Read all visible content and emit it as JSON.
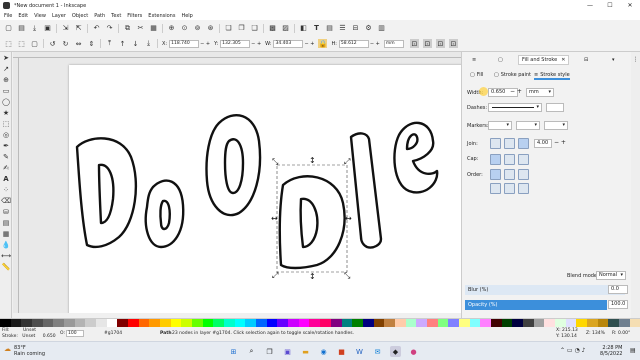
{
  "window": {
    "title": "*New document 1 - Inkscape",
    "minimize": "—",
    "maximize": "☐",
    "close": "✕"
  },
  "menu": [
    "File",
    "Edit",
    "View",
    "Layer",
    "Object",
    "Path",
    "Text",
    "Filters",
    "Extensions",
    "Help"
  ],
  "coords": {
    "x": {
      "label": "X:",
      "value": "118.740"
    },
    "y": {
      "label": "Y:",
      "value": "132.305"
    },
    "w": {
      "label": "W:",
      "value": "34.403"
    },
    "h": {
      "label": "H:",
      "value": "58.612"
    },
    "unit": "mm"
  },
  "dock": {
    "tab_fill_stroke": "Fill and Stroke",
    "subtabs": {
      "fill": "Fill",
      "stroke_paint": "Stroke paint",
      "stroke_style": "Stroke style"
    },
    "width_label": "Width:",
    "width_value": "0.650",
    "width_unit": "mm",
    "dashes_label": "Dashes:",
    "markers_label": "Markers:",
    "join_label": "Join:",
    "join_value": "4.00",
    "cap_label": "Cap:",
    "order_label": "Order:",
    "blend_label": "Blend mode:",
    "blend_value": "Normal",
    "blur_label": "Blur (%)",
    "blur_value": "0.0",
    "opacity_label": "Opacity (%)",
    "opacity_value": "100.0"
  },
  "status": {
    "fill_label": "Fill:",
    "fill_value": "Unset",
    "stroke_label": "Stroke:",
    "stroke_value": "Unset",
    "stroke_width": "0.650",
    "opacity_label": "O:",
    "opacity_value": "100",
    "layer": "#g1704",
    "message_bold": "Path",
    "message": "23 nodes in layer #g1704. Click selection again to toggle scale/rotation handles.",
    "x_label": "X:",
    "x_value": "215.13",
    "y_label": "Y:",
    "y_value": "130.14",
    "zoom_label": "Z:",
    "zoom_value": "134%",
    "rot_label": "R:",
    "rot_value": "0.00°"
  },
  "taskbar": {
    "weather_temp": "83°F",
    "weather_text": "Rain coming",
    "time": "2:28 PM",
    "date": "8/5/2022"
  },
  "palette": [
    "#000000",
    "#1a1a1a",
    "#333333",
    "#4d4d4d",
    "#666666",
    "#808080",
    "#999999",
    "#b3b3b3",
    "#cccccc",
    "#e6e6e6",
    "#ffffff",
    "#800000",
    "#ff0000",
    "#ff6600",
    "#ff9900",
    "#ffcc00",
    "#ffff00",
    "#ccff00",
    "#66ff00",
    "#00ff00",
    "#00ff66",
    "#00ffcc",
    "#00ffff",
    "#00ccff",
    "#0066ff",
    "#0000ff",
    "#6600ff",
    "#cc00ff",
    "#ff00ff",
    "#ff0099",
    "#ff0066",
    "#800080",
    "#008080",
    "#008000",
    "#000080",
    "#804000",
    "#c08040",
    "#ffccaa",
    "#aaffcc",
    "#ccaaff",
    "#ff8080",
    "#80ff80",
    "#8080ff",
    "#ffff80",
    "#80ffff",
    "#ff80ff",
    "#400000",
    "#004000",
    "#000040",
    "#404040",
    "#a0a0a0",
    "#ffe0e0",
    "#e0ffe0",
    "#e0e0ff",
    "#ffd700",
    "#daa520",
    "#b8860b",
    "#2f4f4f",
    "#708090",
    "#f5deb3"
  ],
  "colors": {
    "accent": "#3c8fdb",
    "selected": "#b8d0f0"
  }
}
